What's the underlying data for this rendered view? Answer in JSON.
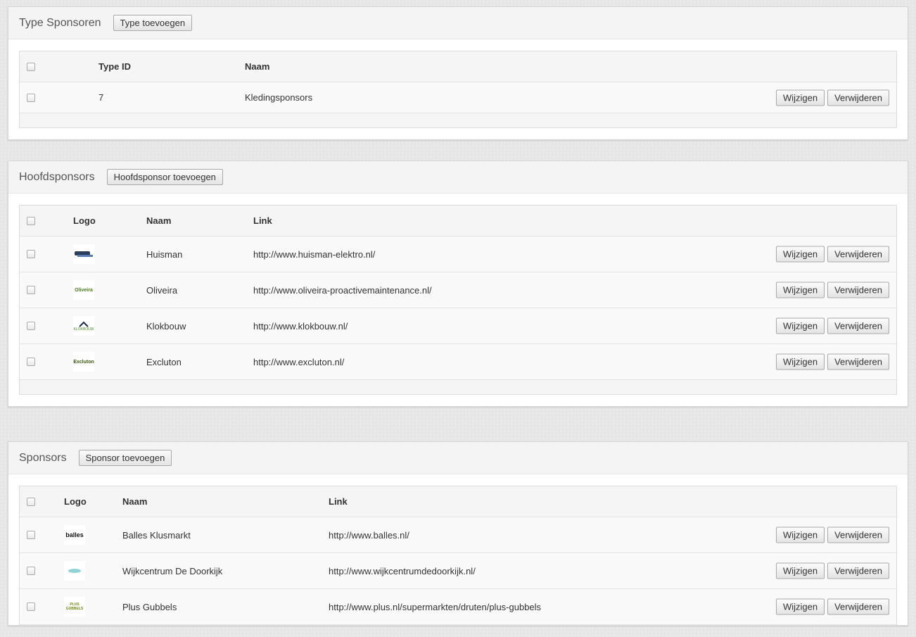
{
  "type_sponsoren": {
    "title": "Type Sponsoren",
    "add_label": "Type toevoegen",
    "columns": {
      "id": "Type ID",
      "naam": "Naam"
    },
    "rows": [
      {
        "id": "7",
        "naam": "Kledingsponsors"
      }
    ]
  },
  "hoofdsponsors": {
    "title": "Hoofdsponsors",
    "add_label": "Hoofdsponsor toevoegen",
    "columns": {
      "logo": "Logo",
      "naam": "Naam",
      "link": "Link"
    },
    "rows": [
      {
        "naam": "Huisman",
        "link": "http://www.huisman-elektro.nl/",
        "logo_text": ""
      },
      {
        "naam": "Oliveira",
        "link": "http://www.oliveira-proactivemaintenance.nl/",
        "logo_text": "Oliveira"
      },
      {
        "naam": "Klokbouw",
        "link": "http://www.klokbouw.nl/",
        "logo_text": "KLOKBOUW"
      },
      {
        "naam": "Excluton",
        "link": "http://www.excluton.nl/",
        "logo_text": "Excluton"
      }
    ]
  },
  "sponsors": {
    "title": "Sponsors",
    "add_label": "Sponsor toevoegen",
    "columns": {
      "logo": "Logo",
      "naam": "Naam",
      "link": "Link"
    },
    "rows": [
      {
        "naam": "Balles Klusmarkt",
        "link": "http://www.balles.nl/",
        "logo_text": "balles"
      },
      {
        "naam": "Wijkcentrum De Doorkijk",
        "link": "http://www.wijkcentrumdedoorkijk.nl/",
        "logo_text": ""
      },
      {
        "naam": "Plus Gubbels",
        "link": "http://www.plus.nl/supermarkten/druten/plus-gubbels",
        "logo_text": "PLUS GUBBELS"
      }
    ]
  },
  "row_actions": {
    "edit": "Wijzigen",
    "delete": "Verwijderen"
  }
}
